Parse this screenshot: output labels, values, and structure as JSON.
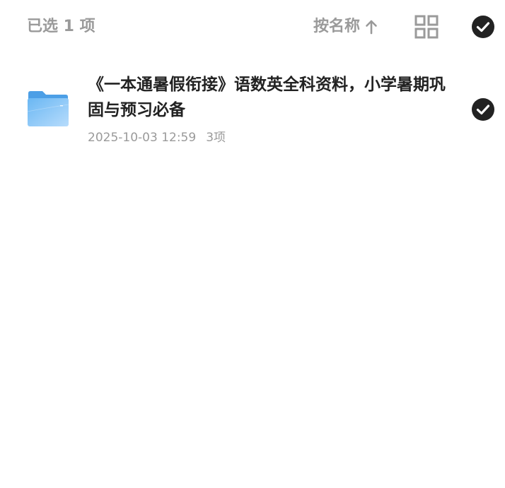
{
  "header": {
    "selected_text": "已选 1 项",
    "sort_label": "按名称",
    "sort_direction_icon": "arrow-up-icon",
    "view_toggle_icon": "grid-view-icon",
    "select_all_icon": "check-circle-icon"
  },
  "files": [
    {
      "name": "《一本通暑假衔接》语数英全科资料，小学暑期巩固与预习必备",
      "date": "2025-10-03 12:59",
      "count": "3项",
      "icon": "folder-icon",
      "selected": true
    }
  ],
  "colors": {
    "muted_text": "#9a9a9a",
    "primary_text": "#222222",
    "check_fill": "#222222",
    "folder_light": "#a9d4fb",
    "folder_dark": "#5aaef0"
  }
}
